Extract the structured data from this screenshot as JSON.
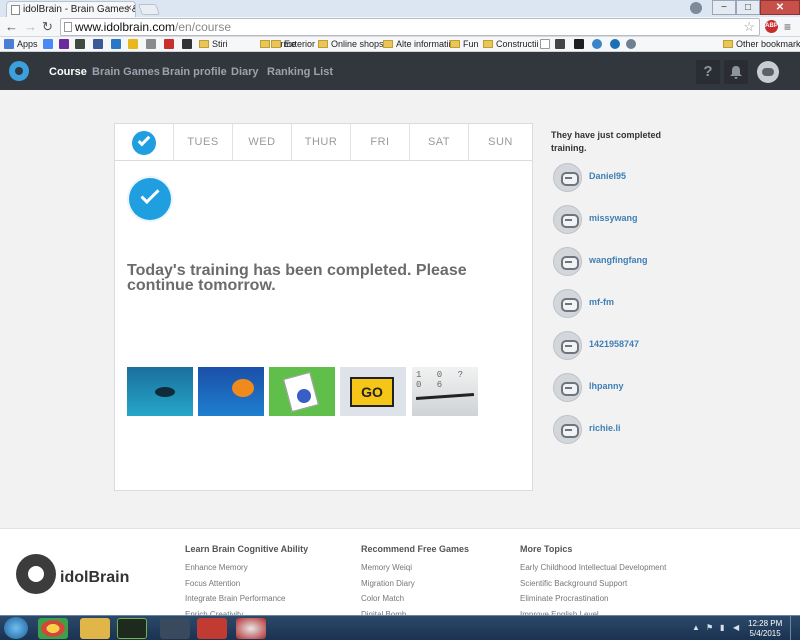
{
  "browser": {
    "tab_title": "idolBrain - Brain Games &",
    "tab_close": "×",
    "url_host": "www.idolbrain.com",
    "url_path": "/en/course",
    "abp_label": "ABP",
    "window_buttons": {
      "minimize": "−",
      "maximize": "□",
      "close": "✕"
    }
  },
  "bookmarks": {
    "items": [
      "Apps",
      "Stiri",
      "Firme",
      "Exterior",
      "Online shops",
      "Alte informatii",
      "Fun",
      "Constructii"
    ],
    "other": "Other bookmarks"
  },
  "site_nav": {
    "items": [
      "Course",
      "Brain Games",
      "Brain profile",
      "Diary",
      "Ranking List"
    ],
    "help_icon": "?"
  },
  "week": {
    "days": [
      "TUES",
      "WED",
      "THUR",
      "FRI",
      "SAT",
      "SUN"
    ]
  },
  "training": {
    "message": "Today's training has been completed. Please continue tomorrow.",
    "game_t5_digits": "1 0 ? 0 6",
    "game_t4_sign": "GO"
  },
  "sidebar": {
    "title": "They have just completed training.",
    "users": [
      "Daniel95",
      "missywang",
      "wangfingfang",
      "mf-fm",
      "1421958747",
      "lhpanny",
      "richie.li"
    ]
  },
  "footer": {
    "brand": "idolBrain",
    "col1": {
      "title": "Learn Brain Cognitive Ability",
      "links": [
        "Enhance Memory",
        "Focus Attention",
        "Integrate Brain Performance",
        "Enrich Creativity"
      ]
    },
    "col2": {
      "title": "Recommend Free Games",
      "links": [
        "Memory Weiqi",
        "Migration Diary",
        "Color Match",
        "Digital Bomb"
      ]
    },
    "col3": {
      "title": "More Topics",
      "links": [
        "Early Childhood Intellectual Development",
        "Scientific Background Support",
        "Eliminate Procrastination",
        "Improve English Level"
      ]
    }
  },
  "taskbar": {
    "time": "12:28 PM",
    "date": "5/4/2015"
  },
  "colors": {
    "accent": "#1f9ee0",
    "header_bg": "#32373e",
    "link": "#3f7fb5"
  }
}
